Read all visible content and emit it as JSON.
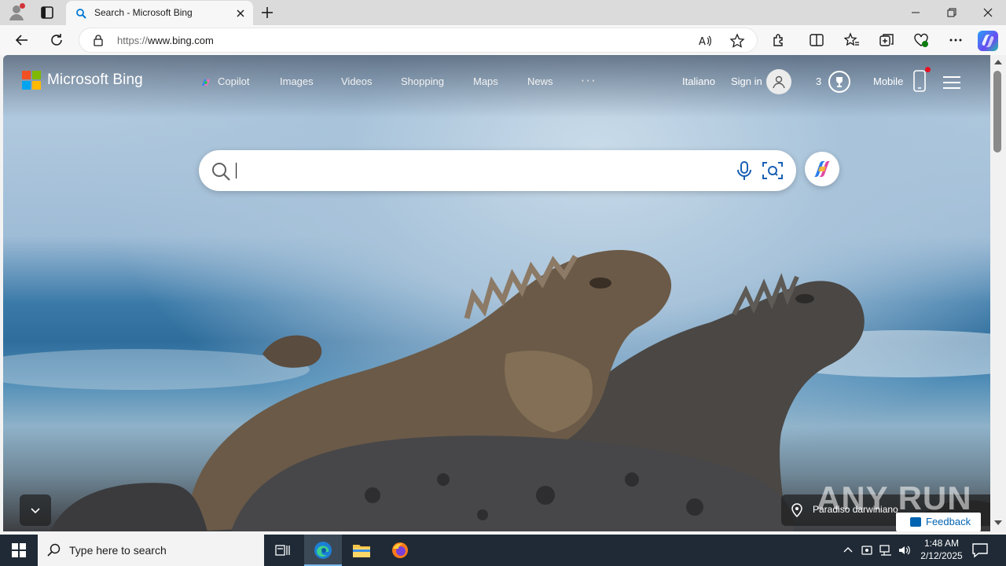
{
  "browser": {
    "tab_title": "Search - Microsoft Bing",
    "url_prefix": "https://",
    "url_host": "www.bing.com"
  },
  "bing": {
    "logo_text": "Microsoft Bing",
    "nav": [
      {
        "label": "Copilot"
      },
      {
        "label": "Images"
      },
      {
        "label": "Videos"
      },
      {
        "label": "Shopping"
      },
      {
        "label": "Maps"
      },
      {
        "label": "News"
      }
    ],
    "more_label": "···",
    "language": "Italiano",
    "sign_in": "Sign in",
    "rewards_count": "3",
    "mobile": "Mobile",
    "search_value": "",
    "location_caption": "Paradiso darwiniano",
    "feedback": "Feedback",
    "watermark": "ANY RUN"
  },
  "taskbar": {
    "search_placeholder": "Type here to search",
    "time": "1:48 AM",
    "date": "2/12/2025"
  },
  "colors": {
    "ms_red": "#f25022",
    "ms_green": "#7fba00",
    "ms_blue": "#00a4ef",
    "ms_yellow": "#ffb900",
    "edge_accent": "#0078d4",
    "taskbar_bg": "#1f2a36"
  }
}
